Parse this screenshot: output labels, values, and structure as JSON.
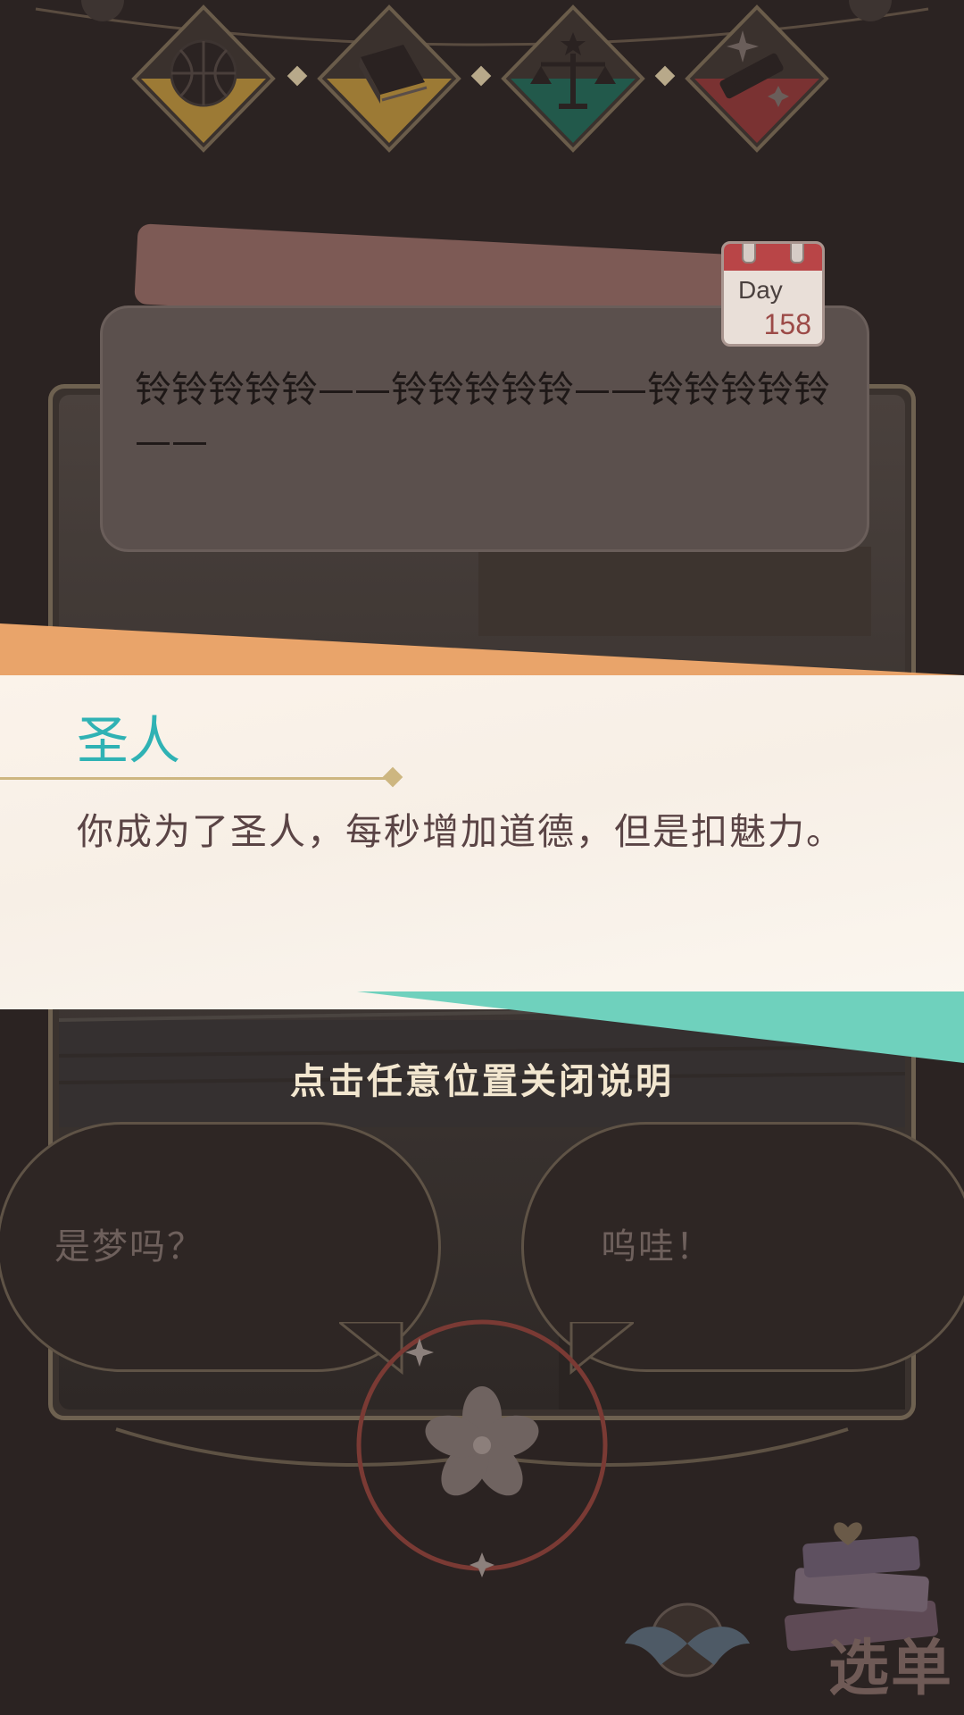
{
  "stats": [
    {
      "name": "basketball-icon",
      "color": "#c99a2e"
    },
    {
      "name": "book-icon",
      "color": "#c99a2e"
    },
    {
      "name": "scale-icon",
      "color": "#1f8a6d"
    },
    {
      "name": "comb-icon",
      "color": "#c23e3e"
    }
  ],
  "calendar": {
    "label": "Day",
    "day": "158"
  },
  "dialogue": {
    "text": "铃铃铃铃铃——铃铃铃铃铃——铃铃铃铃铃——"
  },
  "info_banner": {
    "title": "圣人",
    "body": "你成为了圣人，每秒增加道德，但是扣魅力。"
  },
  "close_hint": "点击任意位置关闭说明",
  "choices": [
    {
      "label": "是梦吗？"
    },
    {
      "label": "呜哇！"
    }
  ],
  "menu": {
    "label": "选单"
  },
  "colors": {
    "accent_teal": "#2fb2b4",
    "banner_orange": "#e9a46a",
    "banner_teal": "#6fd1bd"
  }
}
